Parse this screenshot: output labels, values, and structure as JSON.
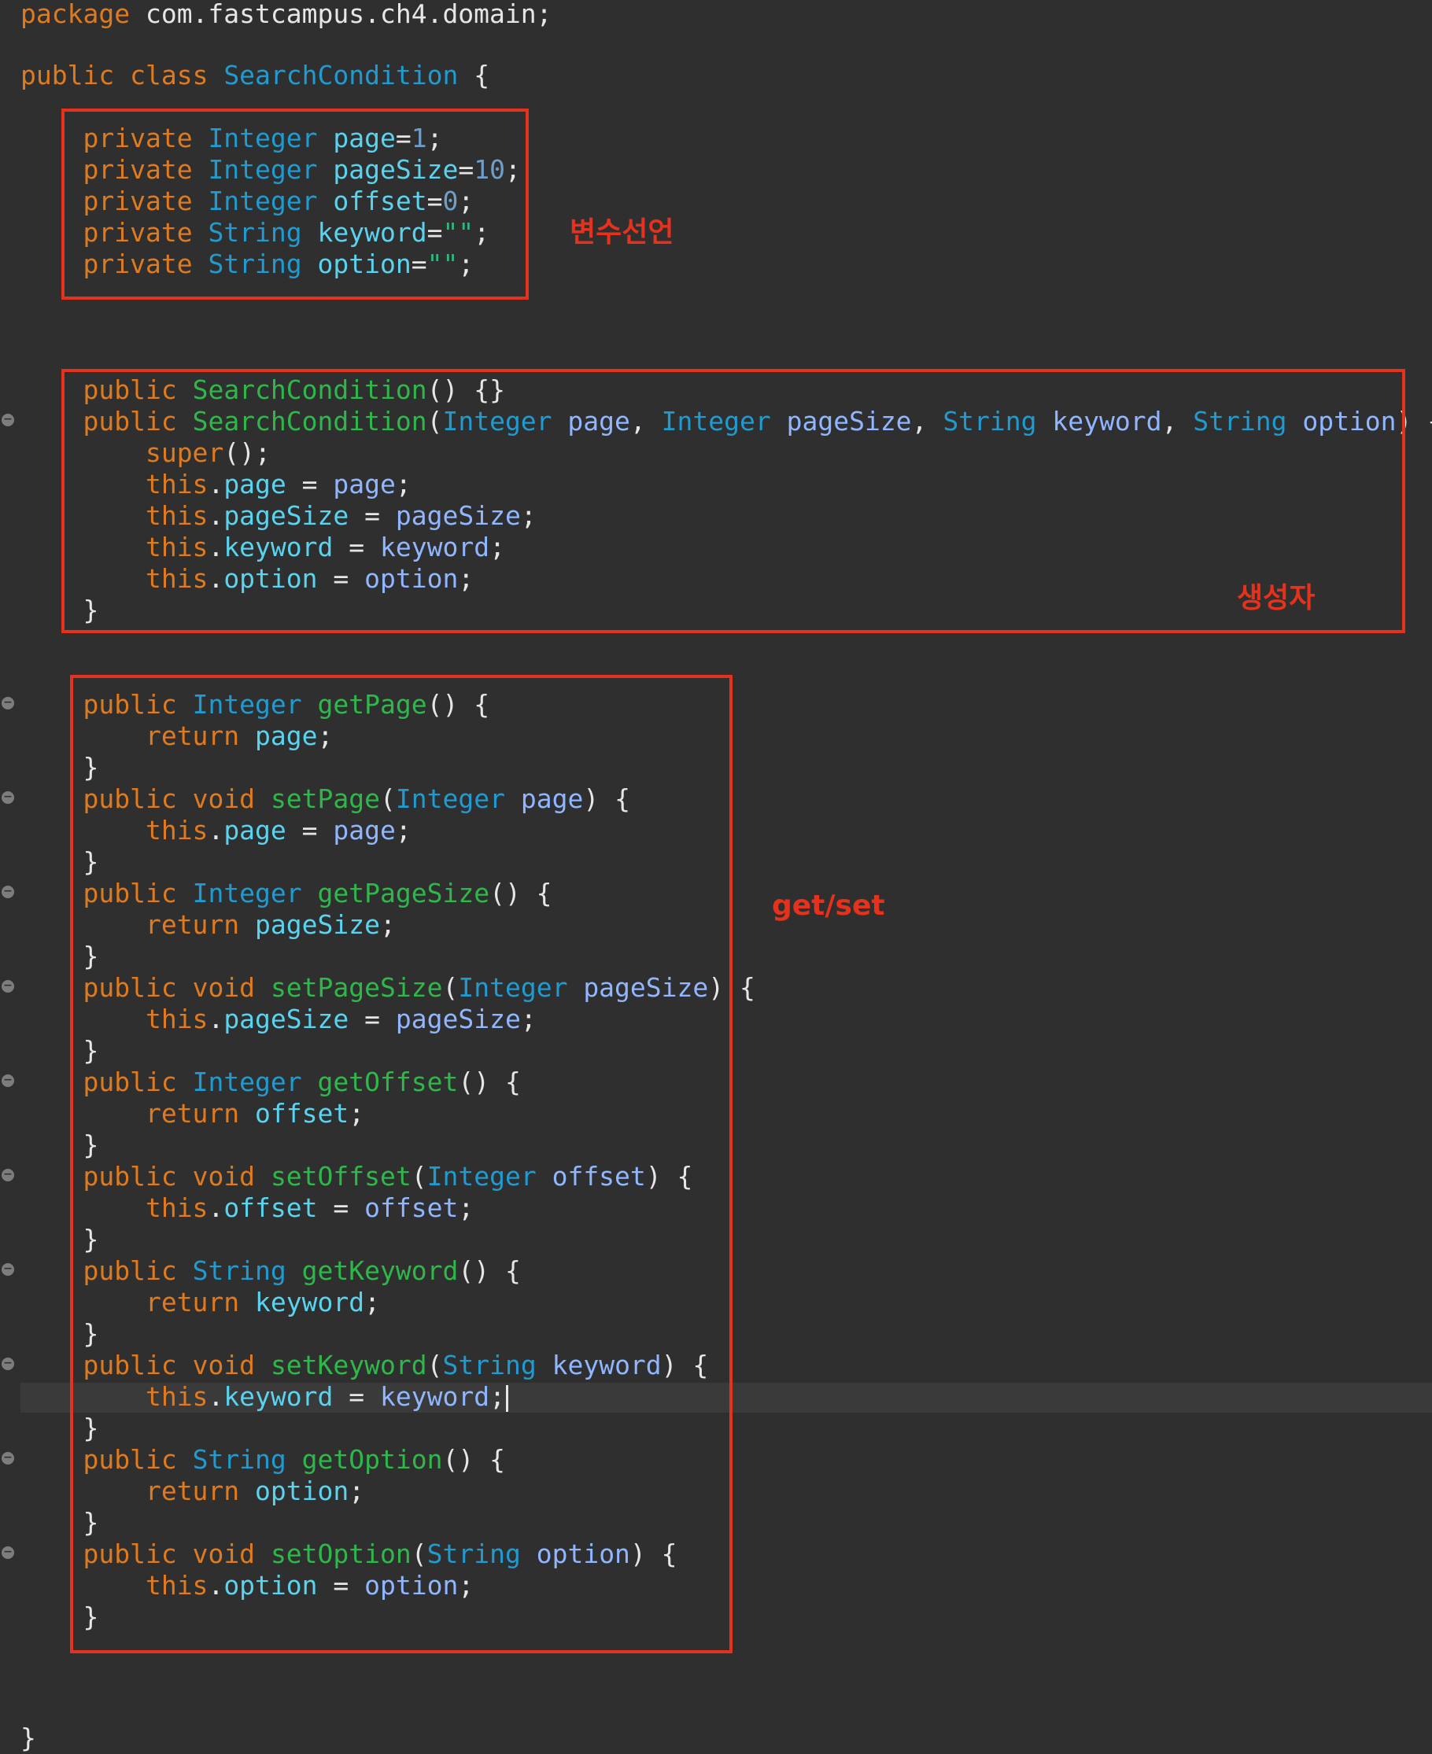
{
  "code": {
    "package_kw": "package",
    "package_name": "com.fastcampus.ch4.domain;",
    "kw_public": "public",
    "kw_class": "class",
    "kw_private": "private",
    "kw_void": "void",
    "kw_return": "return",
    "kw_this": "this",
    "kw_super": "super",
    "type_integer": "Integer",
    "type_string": "String",
    "class_name": "SearchCondition",
    "open_brace": "{",
    "close_brace": "}",
    "fields": [
      {
        "name": "page",
        "init": "1"
      },
      {
        "name": "pageSize",
        "init": "10"
      },
      {
        "name": "offset",
        "init": "0"
      },
      {
        "name": "keyword",
        "init": "\"\""
      },
      {
        "name": "option",
        "init": "\"\""
      }
    ],
    "methods": {
      "getPage": "getPage",
      "setPage": "setPage",
      "getPageSize": "getPageSize",
      "setPageSize": "setPageSize",
      "getOffset": "getOffset",
      "setOffset": "setOffset",
      "getKeyword": "getKeyword",
      "setKeyword": "setKeyword",
      "getOption": "getOption",
      "setOption": "setOption"
    }
  },
  "annotations": {
    "fields_label": "변수선언",
    "constructor_label": "생성자",
    "accessors_label": "get/set"
  },
  "colors": {
    "background": "#2f2f2f",
    "keyword": "#e07a1f",
    "type": "#1f9bd1",
    "method": "#2fb84a",
    "variable": "#8fb6ff",
    "field": "#5ad3ef",
    "number": "#6f9fc8",
    "string": "#2bb87a",
    "annotation": "#e6311c"
  }
}
